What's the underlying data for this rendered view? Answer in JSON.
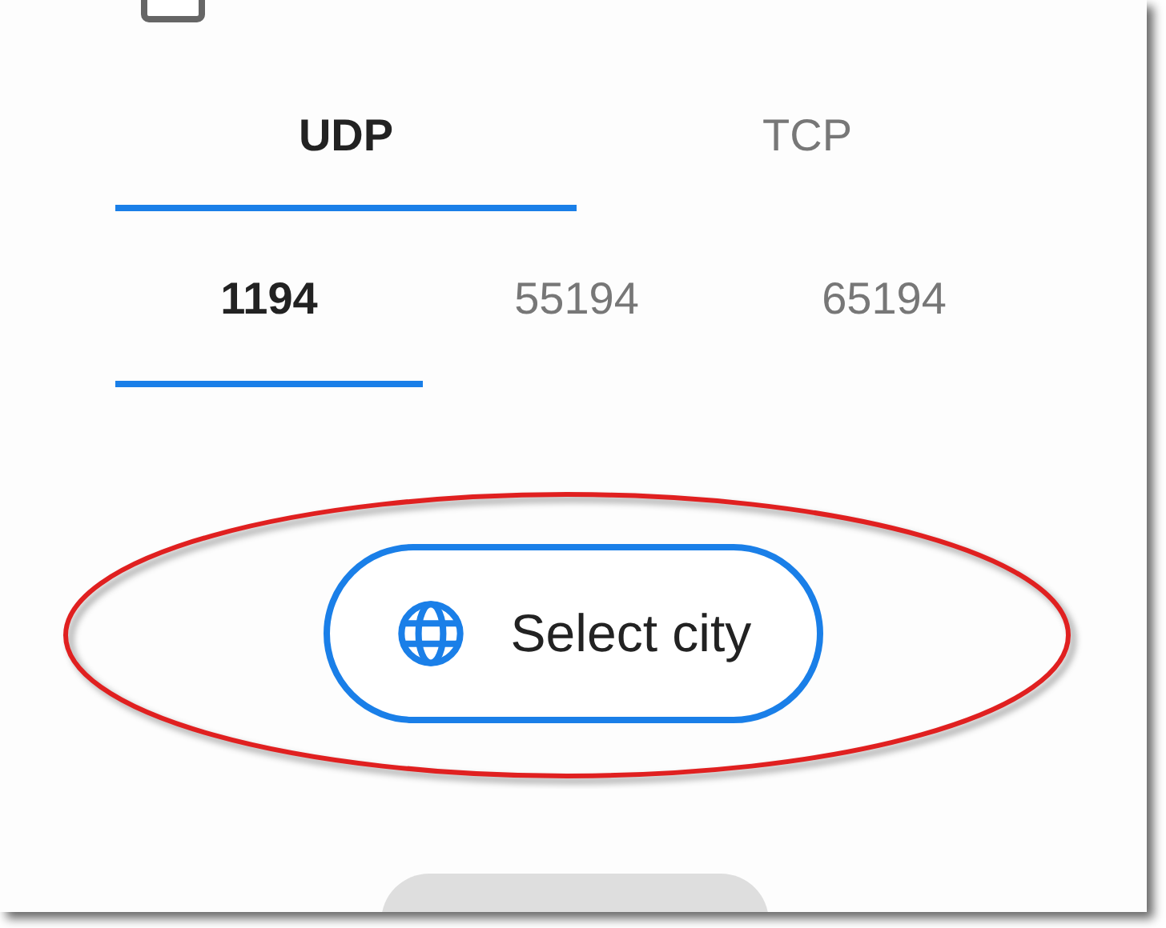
{
  "reconnect_option": {
    "checked": false
  },
  "protocol_tabs": [
    {
      "label": "UDP",
      "selected": true
    },
    {
      "label": "TCP",
      "selected": false
    }
  ],
  "port_tabs": [
    {
      "label": "1194",
      "selected": true
    },
    {
      "label": "55194",
      "selected": false
    },
    {
      "label": "65194",
      "selected": false
    }
  ],
  "select_city_button": {
    "label": "Select city"
  }
}
